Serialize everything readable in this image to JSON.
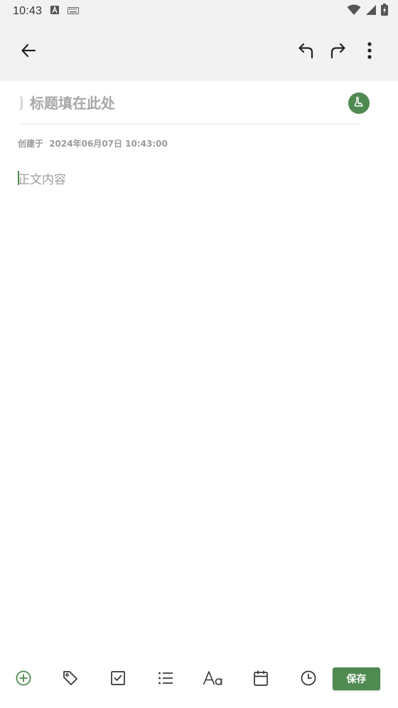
{
  "status_bar": {
    "time": "10:43",
    "icons": [
      "app-a-icon",
      "keyboard-icon",
      "wifi-icon",
      "cell-signal-icon",
      "battery-charging-icon"
    ]
  },
  "toolbar": {
    "icons": [
      "back-arrow-icon",
      "undo-icon",
      "redo-icon",
      "more-vert-icon"
    ]
  },
  "editor": {
    "title_placeholder": "标题填在此处",
    "created_label": "创建于",
    "created_time": "2024年06月07日 10:43:00",
    "body_placeholder": "正文内容"
  },
  "bottom_bar": {
    "icons": [
      "add-circle-icon",
      "tag-icon",
      "checkbox-icon",
      "list-icon",
      "text-format-icon",
      "calendar-icon",
      "clock-icon"
    ],
    "save_label": "保存"
  },
  "colors": {
    "accent": "#4f8a50",
    "toolbar_bg": "#f2f2f2"
  }
}
